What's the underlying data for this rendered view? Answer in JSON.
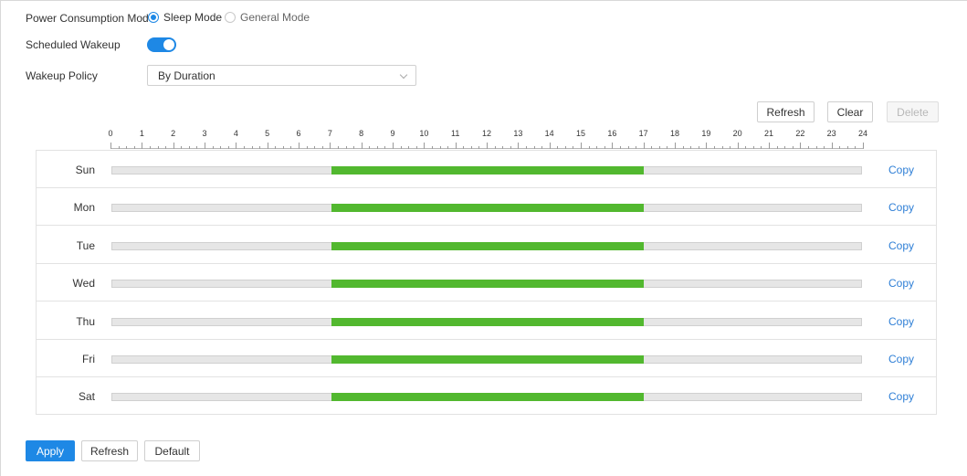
{
  "power_mode": {
    "label": "Power Consumption Mode",
    "options": [
      {
        "label": "Sleep Mode",
        "selected": true
      },
      {
        "label": "General Mode",
        "selected": false
      }
    ]
  },
  "scheduled_wakeup": {
    "label": "Scheduled Wakeup",
    "enabled": true
  },
  "wakeup_policy": {
    "label": "Wakeup Policy",
    "value": "By Duration"
  },
  "schedule_toolbar": {
    "refresh": "Refresh",
    "clear": "Clear",
    "delete": "Delete"
  },
  "ruler": {
    "hours": [
      "0",
      "1",
      "2",
      "3",
      "4",
      "5",
      "6",
      "7",
      "8",
      "9",
      "10",
      "11",
      "12",
      "13",
      "14",
      "15",
      "16",
      "17",
      "18",
      "19",
      "20",
      "21",
      "22",
      "23",
      "24"
    ]
  },
  "schedule": [
    {
      "day": "Sun",
      "periods": [
        {
          "start": 7,
          "end": 17
        }
      ],
      "copy": "Copy"
    },
    {
      "day": "Mon",
      "periods": [
        {
          "start": 7,
          "end": 17
        }
      ],
      "copy": "Copy"
    },
    {
      "day": "Tue",
      "periods": [
        {
          "start": 7,
          "end": 17
        }
      ],
      "copy": "Copy"
    },
    {
      "day": "Wed",
      "periods": [
        {
          "start": 7,
          "end": 17
        }
      ],
      "copy": "Copy"
    },
    {
      "day": "Thu",
      "periods": [
        {
          "start": 7,
          "end": 17
        }
      ],
      "copy": "Copy"
    },
    {
      "day": "Fri",
      "periods": [
        {
          "start": 7,
          "end": 17
        }
      ],
      "copy": "Copy"
    },
    {
      "day": "Sat",
      "periods": [
        {
          "start": 7,
          "end": 17
        }
      ],
      "copy": "Copy"
    }
  ],
  "footer": {
    "apply": "Apply",
    "refresh": "Refresh",
    "default": "Default"
  },
  "colors": {
    "accent": "#1e88e5",
    "period": "#52b82f",
    "link": "#2f7fd6"
  }
}
